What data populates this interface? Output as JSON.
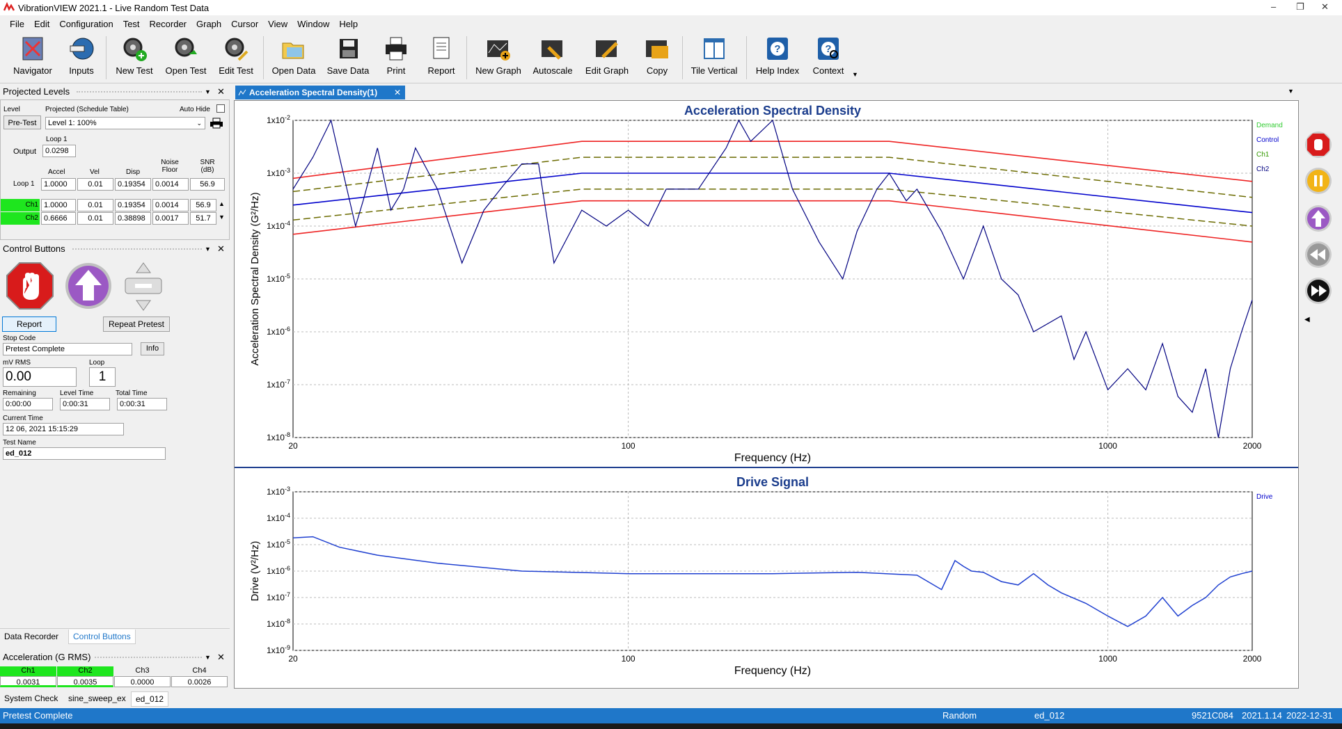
{
  "window": {
    "title": "VibrationVIEW 2021.1 - Live Random Test Data"
  },
  "menu": [
    "File",
    "Edit",
    "Configuration",
    "Test",
    "Recorder",
    "Graph",
    "Cursor",
    "View",
    "Window",
    "Help"
  ],
  "toolbar": [
    "Navigator",
    "Inputs",
    "New Test",
    "Open Test",
    "Edit Test",
    "Open Data",
    "Save Data",
    "Print",
    "Report",
    "New Graph",
    "Autoscale",
    "Edit Graph",
    "Copy",
    "Tile Vertical",
    "Help Index",
    "Context"
  ],
  "projected": {
    "header": "Projected Levels",
    "level_label": "Level",
    "projected_label": "Projected (Schedule Table)",
    "auto_hide": "Auto Hide",
    "pretest_btn": "Pre-Test",
    "level_select": "Level 1: 100%",
    "loop_label": "Loop 1",
    "output_label": "Output",
    "output_value": "0.0298",
    "cols": [
      "Accel",
      "Vel",
      "Disp",
      "Noise Floor",
      "SNR (dB)"
    ],
    "loop_row": {
      "label": "Loop 1",
      "values": [
        "1.0000",
        "0.01",
        "0.19354",
        "0.0014",
        "56.9"
      ]
    },
    "ch_rows": [
      {
        "label": "Ch1",
        "values": [
          "1.0000",
          "0.01",
          "0.19354",
          "0.0014",
          "56.9"
        ]
      },
      {
        "label": "Ch2",
        "values": [
          "0.6666",
          "0.01",
          "0.38898",
          "0.0017",
          "51.7"
        ]
      }
    ]
  },
  "control": {
    "header": "Control Buttons",
    "report_btn": "Report",
    "repeat_btn": "Repeat Pretest",
    "stop_code_label": "Stop Code",
    "stop_code": "Pretest Complete",
    "info_btn": "Info",
    "mv_label": "mV RMS",
    "mv_value": "0.00",
    "loop_label": "Loop",
    "loop_value": "1",
    "remaining_label": "Remaining",
    "remaining": "0:00:00",
    "level_time_label": "Level Time",
    "level_time": "0:00:31",
    "total_time_label": "Total Time",
    "total_time": "0:00:31",
    "current_time_label": "Current Time",
    "current_time": "12 06, 2021 15:15:29",
    "test_name_label": "Test Name",
    "test_name": "ed_012"
  },
  "bottom_tabs": [
    "Data Recorder",
    "Control Buttons"
  ],
  "accel": {
    "header": "Acceleration (G RMS)",
    "channels": [
      "Ch1",
      "Ch2",
      "Ch3",
      "Ch4"
    ],
    "values": [
      "0.0031",
      "0.0035",
      "0.0000",
      "0.0026"
    ]
  },
  "test_tabs": [
    "System Check",
    "sine_sweep_ex",
    "ed_012"
  ],
  "doc_tab": "Acceleration Spectral Density(1)",
  "graph1": {
    "title": "Acceleration Spectral Density",
    "ylabel": "Acceleration Spectral Density (G²/Hz)",
    "xlabel": "Frequency (Hz)",
    "yticks": [
      "1x10-2",
      "1x10-3",
      "1x10-4",
      "1x10-5",
      "1x10-6",
      "1x10-7",
      "1x10-8"
    ],
    "xticks": [
      "20",
      "100",
      "1000",
      "2000"
    ],
    "legend": [
      "Demand",
      "Control",
      "Ch1",
      "Ch2"
    ]
  },
  "graph2": {
    "title": "Drive Signal",
    "ylabel": "Drive (V²/Hz)",
    "xlabel": "Frequency (Hz)",
    "yticks": [
      "1x10-3",
      "1x10-4",
      "1x10-5",
      "1x10-6",
      "1x10-7",
      "1x10-8",
      "1x10-9"
    ],
    "xticks": [
      "20",
      "100",
      "1000",
      "2000"
    ],
    "legend": [
      "Drive"
    ]
  },
  "status": {
    "left": "Pretest Complete",
    "mode": "Random",
    "test": "ed_012",
    "serial": "9521C084",
    "version": "2021.1.14",
    "date": "2022-12-31"
  },
  "colors": {
    "demand": "#33cc33",
    "control": "#0000cc",
    "ch1": "#339900",
    "ch2": "#000080",
    "red_limit": "#ee2222",
    "warn": "#6b6b00",
    "accent": "#1f77c9"
  },
  "chart_data": [
    {
      "type": "line",
      "title": "Acceleration Spectral Density",
      "xlabel": "Frequency (Hz)",
      "ylabel": "Acceleration Spectral Density (G²/Hz)",
      "xscale": "log",
      "yscale": "log",
      "xlim": [
        20,
        2000
      ],
      "ylim": [
        1e-08,
        0.01
      ],
      "series": [
        {
          "name": "Demand",
          "x": [
            20,
            80,
            350,
            2000
          ],
          "y": [
            0.00025,
            0.001,
            0.001,
            0.00018
          ]
        },
        {
          "x": [
            20,
            80,
            350,
            2000
          ],
          "y": [
            0.0008,
            0.004,
            0.004,
            0.0007
          ]
        },
        {
          "x": [
            20,
            80,
            350,
            2000
          ],
          "y": [
            7e-05,
            0.0003,
            0.0003,
            5e-05
          ]
        },
        {
          "x": [
            20,
            80,
            350,
            2000
          ],
          "y": [
            0.00045,
            0.002,
            0.002,
            0.00035
          ]
        },
        {
          "x": [
            20,
            80,
            350,
            2000
          ],
          "y": [
            0.00013,
            0.0005,
            0.0005,
            0.0001
          ]
        },
        {
          "name": "Ch2",
          "x": [
            20,
            22,
            24,
            25,
            27,
            28,
            30,
            32,
            34,
            36,
            40,
            45,
            50,
            55,
            60,
            65,
            70,
            80,
            90,
            100,
            110,
            120,
            140,
            160,
            170,
            180,
            200,
            220,
            250,
            280,
            300,
            330,
            350,
            380,
            400,
            450,
            500,
            550,
            600,
            650,
            700,
            800,
            850,
            900,
            1000,
            1100,
            1200,
            1300,
            1400,
            1500,
            1600,
            1700,
            1800,
            1900,
            2000
          ],
          "y": [
            0.0005,
            0.002,
            0.01,
            0.002,
            0.0001,
            0.0003,
            0.003,
            0.0002,
            0.0005,
            0.003,
            0.0005,
            2e-05,
            0.0002,
            0.0006,
            0.0015,
            0.0015,
            2e-05,
            0.0002,
            0.0001,
            0.0002,
            0.0001,
            0.0005,
            0.0005,
            0.003,
            0.01,
            0.004,
            0.01,
            0.0005,
            5e-05,
            1e-05,
            8e-05,
            0.0005,
            0.001,
            0.0003,
            0.0005,
            8e-05,
            1e-05,
            0.0001,
            1e-05,
            5e-06,
            1e-06,
            2e-06,
            3e-07,
            1e-06,
            8e-08,
            2e-07,
            8e-08,
            6e-07,
            6e-08,
            3e-08,
            2e-07,
            1e-08,
            2e-07,
            1e-06,
            4e-06
          ]
        }
      ]
    },
    {
      "type": "line",
      "title": "Drive Signal",
      "xlabel": "Frequency (Hz)",
      "ylabel": "Drive (V²/Hz)",
      "xscale": "log",
      "yscale": "log",
      "xlim": [
        20,
        2000
      ],
      "ylim": [
        1e-09,
        0.001
      ],
      "series": [
        {
          "name": "Drive",
          "x": [
            20,
            22,
            25,
            30,
            40,
            60,
            100,
            150,
            200,
            300,
            400,
            450,
            480,
            500,
            520,
            550,
            600,
            650,
            700,
            750,
            800,
            900,
            1000,
            1100,
            1200,
            1300,
            1400,
            1500,
            1600,
            1700,
            1800,
            1900,
            2000
          ],
          "y": [
            1.8e-05,
            2e-05,
            8e-06,
            4e-06,
            2e-06,
            1e-06,
            8e-07,
            8e-07,
            8e-07,
            9e-07,
            7e-07,
            2e-07,
            2.5e-06,
            1.5e-06,
            1e-06,
            9e-07,
            4e-07,
            3e-07,
            8e-07,
            3e-07,
            1.5e-07,
            6e-08,
            2e-08,
            8e-09,
            2e-08,
            1e-07,
            2e-08,
            5e-08,
            1e-07,
            3e-07,
            6e-07,
            8e-07,
            1e-06
          ]
        }
      ]
    }
  ]
}
